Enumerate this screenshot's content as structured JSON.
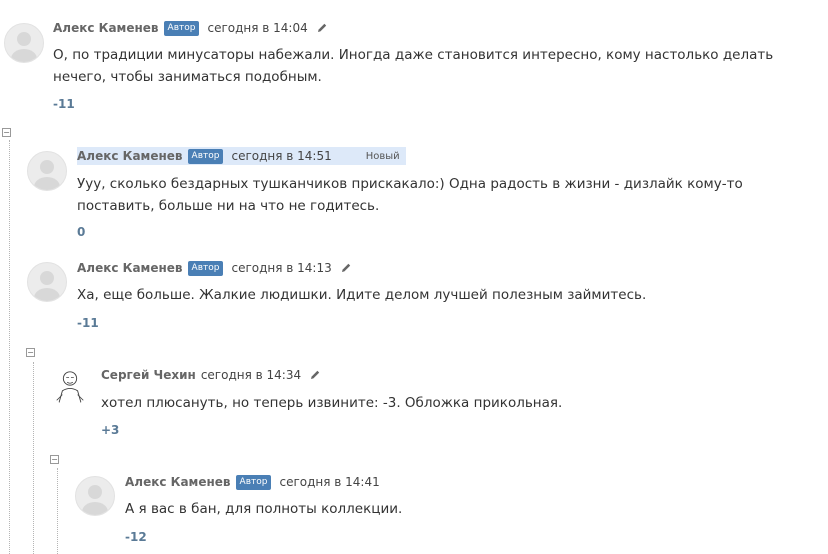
{
  "comments": [
    {
      "author": "Алекс Каменев",
      "badge": "Автор",
      "time": "сегодня в 14:04",
      "text": "О, по традиции минусаторы набежали. Иногда даже становится интересно, кому настолько делать нечего, чтобы заниматься подобным.",
      "vote": "-11"
    },
    {
      "author": "Алекс Каменев",
      "badge": "Автор",
      "time": "сегодня в 14:51",
      "new_label": "Новый",
      "text": "Ууу, сколько бездарных тушканчиков прискакало:) Одна радость в жизни - дизлайк кому-то поставить, больше ни на что не годитесь.",
      "vote": "0"
    },
    {
      "author": "Алекс Каменев",
      "badge": "Автор",
      "time": "сегодня в 14:13",
      "text": "Ха, еще больше. Жалкие людишки. Идите делом лучшей полезным займитесь.",
      "vote": "-11"
    },
    {
      "author": "Сергей Чехин",
      "time": "сегодня в 14:34",
      "text": "хотел плюсануть, но теперь извините: -3. Обложка прикольная.",
      "vote": "+3"
    },
    {
      "author": "Алекс Каменев",
      "badge": "Автор",
      "time": "сегодня в 14:41",
      "text": "А я вас в бан, для полноты коллекции.",
      "vote": "-12"
    }
  ],
  "icons": {
    "avatar": "default-avatar-icon",
    "edit": "pencil-icon",
    "collapse": "collapse-toggle-icon"
  },
  "colors": {
    "badge": "#4a7fb5",
    "new_highlight": "#dde9f9",
    "vote": "#5a7a96"
  }
}
